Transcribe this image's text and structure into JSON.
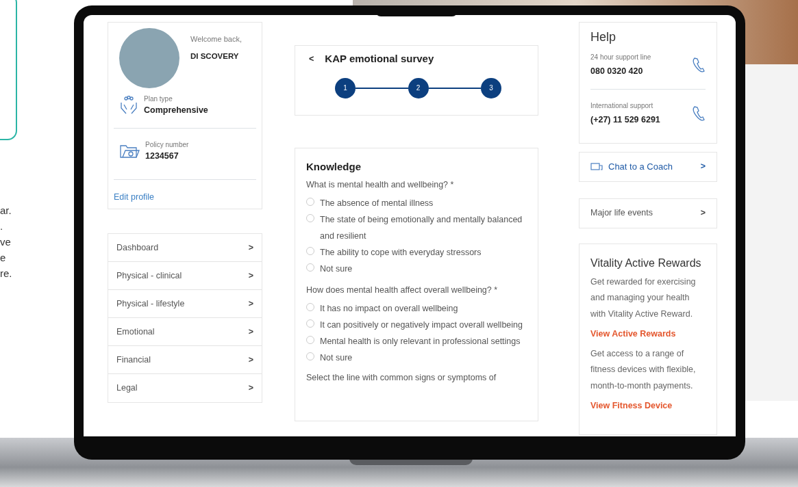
{
  "background_text": [
    "ar.",
    ".",
    "ve",
    "e",
    "re."
  ],
  "profile": {
    "greeting": "Welcome back,",
    "name": "DI SCOVERY",
    "plan_label": "Plan type",
    "plan_value": "Comprehensive",
    "policy_label": "Policy number",
    "policy_value": "1234567",
    "edit_link": "Edit profile"
  },
  "menu": [
    {
      "label": "Dashboard",
      "arrow": ">"
    },
    {
      "label": "Physical - clinical",
      "arrow": ">"
    },
    {
      "label": "Physical - lifestyle",
      "arrow": ">"
    },
    {
      "label": "Emotional",
      "arrow": ">"
    },
    {
      "label": "Financial",
      "arrow": ">"
    },
    {
      "label": "Legal",
      "arrow": ">"
    }
  ],
  "survey": {
    "back": "<",
    "title": "KAP emotional survey",
    "steps": [
      {
        "label": "1",
        "completed": true
      },
      {
        "label": "2",
        "completed": true
      },
      {
        "label": "3",
        "completed": true
      }
    ]
  },
  "form": {
    "heading": "Knowledge",
    "questions": [
      {
        "text": "What is mental health and wellbeing? *",
        "options": [
          {
            "label": "The absence of mental illness",
            "selected": false
          },
          {
            "label": "The state of being emotionally and mentally balanced and resilient",
            "selected": false
          },
          {
            "label": "The ability to cope with everyday stressors",
            "selected": false
          },
          {
            "label": "Not sure",
            "selected": false
          }
        ]
      },
      {
        "text": "How does mental health affect overall wellbeing? *",
        "options": [
          {
            "label": "It has no impact on overall wellbeing",
            "selected": false
          },
          {
            "label": "It can positively or negatively impact overall wellbeing",
            "selected": false
          },
          {
            "label": "Mental health is only relevant in professional settings",
            "selected": false
          },
          {
            "label": "Not sure",
            "selected": false
          }
        ]
      }
    ],
    "cut_question": "Select the line with common signs or symptoms of"
  },
  "help": {
    "title": "Help",
    "lines": [
      {
        "label": "24 hour support line",
        "number": "080 0320 420"
      },
      {
        "label": "International support",
        "number": "(+27) 11 529 6291"
      }
    ]
  },
  "links": [
    {
      "kind": "chat",
      "label": "Chat to a Coach",
      "arrow": ">"
    },
    {
      "kind": "plain",
      "label": "Major life events",
      "arrow": ">"
    }
  ],
  "rewards": {
    "title": "Vitality Active Rewards",
    "text1": "Get rewarded for exercising and managing your health with Vitality Active Reward.",
    "link1": "View Active Rewards",
    "text2": "Get access to a range of fitness devices with flexible, month-to-month payments.",
    "link2": "View Fitness Device"
  }
}
